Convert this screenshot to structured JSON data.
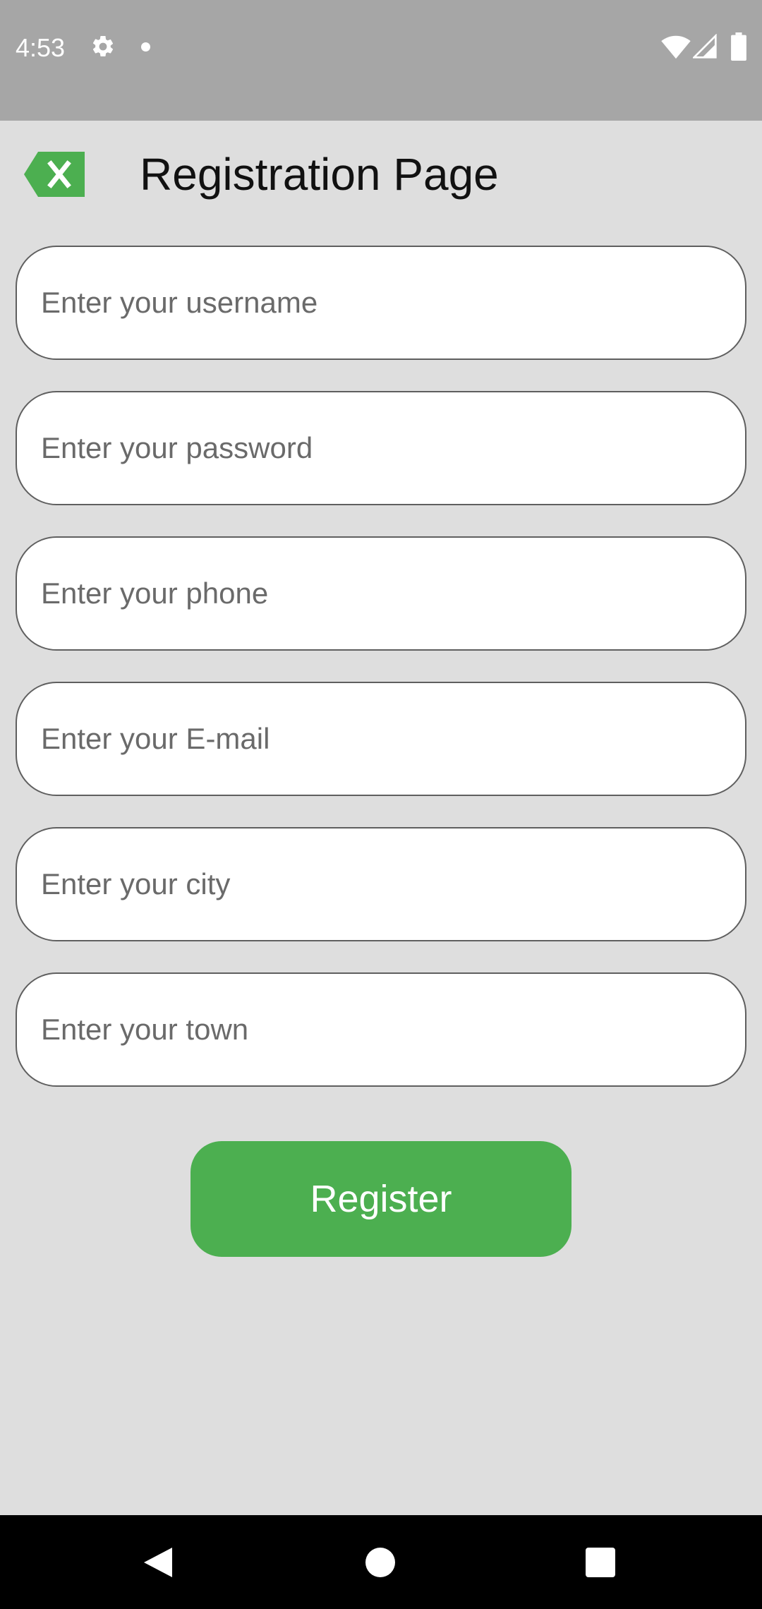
{
  "status_bar": {
    "time": "4:53",
    "icons": [
      "gear-icon",
      "notification-dot-icon",
      "wifi-icon",
      "cellular-signal-icon",
      "battery-icon"
    ]
  },
  "header": {
    "title": "Registration Page",
    "back_icon": "backspace-close-icon",
    "accent_color": "#4caf50"
  },
  "form": {
    "fields": [
      {
        "placeholder": "Enter your username",
        "value": ""
      },
      {
        "placeholder": "Enter your password",
        "value": ""
      },
      {
        "placeholder": "Enter your phone",
        "value": ""
      },
      {
        "placeholder": "Enter your E-mail",
        "value": ""
      },
      {
        "placeholder": "Enter your city",
        "value": ""
      },
      {
        "placeholder": "Enter your town",
        "value": ""
      }
    ],
    "submit_label": "Register",
    "submit_color": "#4caf50"
  },
  "nav_bar": {
    "icons": [
      "nav-back-icon",
      "nav-home-icon",
      "nav-recents-icon"
    ]
  }
}
